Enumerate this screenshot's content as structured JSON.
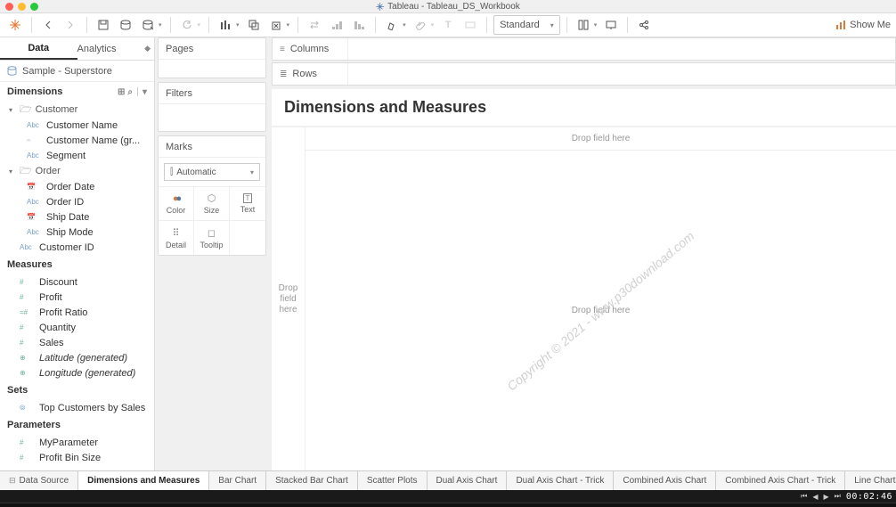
{
  "titlebar": {
    "app": "Tableau",
    "file": "Tableau_DS_Workbook"
  },
  "toolbar": {
    "fit": "Standard",
    "showme": "Show Me"
  },
  "left": {
    "tabs": {
      "data": "Data",
      "analytics": "Analytics"
    },
    "datasource": "Sample - Superstore",
    "sections": {
      "dimensions": "Dimensions",
      "measures": "Measures",
      "sets": "Sets",
      "parameters": "Parameters"
    },
    "folders": {
      "customer": "Customer",
      "order": "Order"
    },
    "dims": {
      "customer_name": "Customer Name",
      "customer_name_gr": "Customer Name (gr...",
      "segment": "Segment",
      "order_date": "Order Date",
      "order_id": "Order ID",
      "ship_date": "Ship Date",
      "ship_mode": "Ship Mode",
      "customer_id": "Customer ID"
    },
    "meas": {
      "discount": "Discount",
      "profit": "Profit",
      "profit_ratio": "Profit Ratio",
      "quantity": "Quantity",
      "sales": "Sales",
      "lat": "Latitude (generated)",
      "lon": "Longitude (generated)"
    },
    "sets_items": {
      "top_customers": "Top Customers by Sales"
    },
    "params": {
      "myparam": "MyParameter",
      "profit_bin": "Profit Bin Size"
    }
  },
  "mid": {
    "pages": "Pages",
    "filters": "Filters",
    "marks": "Marks",
    "mark_type": "Automatic",
    "cells": {
      "color": "Color",
      "size": "Size",
      "text": "Text",
      "detail": "Detail",
      "tooltip": "Tooltip"
    }
  },
  "shelves": {
    "columns": "Columns",
    "rows": "Rows"
  },
  "viz": {
    "title": "Dimensions and Measures",
    "drop_field": "Drop field here",
    "drop_side": "Drop\nfield\nhere",
    "watermark": "Copyright © 2021 - www.p30download.com"
  },
  "bottom": {
    "datasource": "Data Source",
    "tabs": [
      "Dimensions and Measures",
      "Bar Chart",
      "Stacked Bar Chart",
      "Scatter Plots",
      "Dual Axis Chart",
      "Dual Axis Chart - Trick",
      "Combined Axis Chart",
      "Combined Axis Chart - Trick",
      "Line Charts"
    ]
  },
  "player": {
    "time": "00:02:46"
  }
}
